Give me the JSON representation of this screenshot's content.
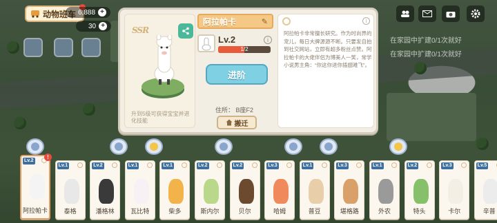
{
  "hud": {
    "tag_label": "动物班车",
    "resource_1": "6,888",
    "resource_2": "30",
    "plus": "+",
    "notices": [
      "在家园中扩建0/1次就好",
      "在家园中扩建0/1次就好"
    ]
  },
  "popup": {
    "rarity": "SSR",
    "unlock_hint": "升到5级可获得宝宝并进化技能",
    "name": "阿拉帕卡",
    "level": "Lv.2",
    "progress_text": "1/2",
    "progress_fraction": 0.5,
    "advance_label": "进阶",
    "address": "住所： B座F2",
    "move_label": "搬迁",
    "description": "阿拉帕卡非常擅长研究。作为时尚界的宠儿，每日大牌源源不断。只要发自拍到社交网站，立即有超多粉丝点赞。阿拉帕卡的大佬伴侣为博美人一笑，常学小说男主角：“你这你进你插翅难飞”。"
  },
  "cards": [
    {
      "name": "阿拉帕卡",
      "level": "Lv.2",
      "selected": true,
      "alert": "!",
      "color": "#f4f4f4"
    },
    {
      "name": "泰格",
      "level": "Lv.1",
      "selected": false,
      "color": "#e8e8e8"
    },
    {
      "name": "潘格林",
      "level": "Lv.2",
      "selected": false,
      "color": "#3a3a3a"
    },
    {
      "name": "瓦比特",
      "level": "Lv.1",
      "selected": false,
      "color": "#f7f0f5"
    },
    {
      "name": "柴多",
      "level": "Lv.1",
      "selected": false,
      "color": "#f1b34a"
    },
    {
      "name": "斯内尔",
      "level": "Lv.2",
      "selected": false,
      "color": "#b9d88a"
    },
    {
      "name": "贝尔",
      "level": "Lv.2",
      "selected": false,
      "color": "#6b4a30"
    },
    {
      "name": "哈姆",
      "level": "Lv.3",
      "selected": false,
      "color": "#f08a5d"
    },
    {
      "name": "普豆",
      "level": "Lv.1",
      "selected": false,
      "color": "#e9cfa9"
    },
    {
      "name": "堪格路",
      "level": "Lv.3",
      "selected": false,
      "color": "#d9a06a"
    },
    {
      "name": "外农",
      "level": "Lv.1",
      "selected": false,
      "color": "#9a9a9a"
    },
    {
      "name": "特头",
      "level": "Lv.2",
      "selected": false,
      "color": "#86c06a"
    },
    {
      "name": "卡尔",
      "level": "Lv.3",
      "selected": false,
      "color": "#f3efe5"
    },
    {
      "name": "辛普",
      "level": "Lv.5",
      "selected": false,
      "color": "#ececec"
    }
  ]
}
